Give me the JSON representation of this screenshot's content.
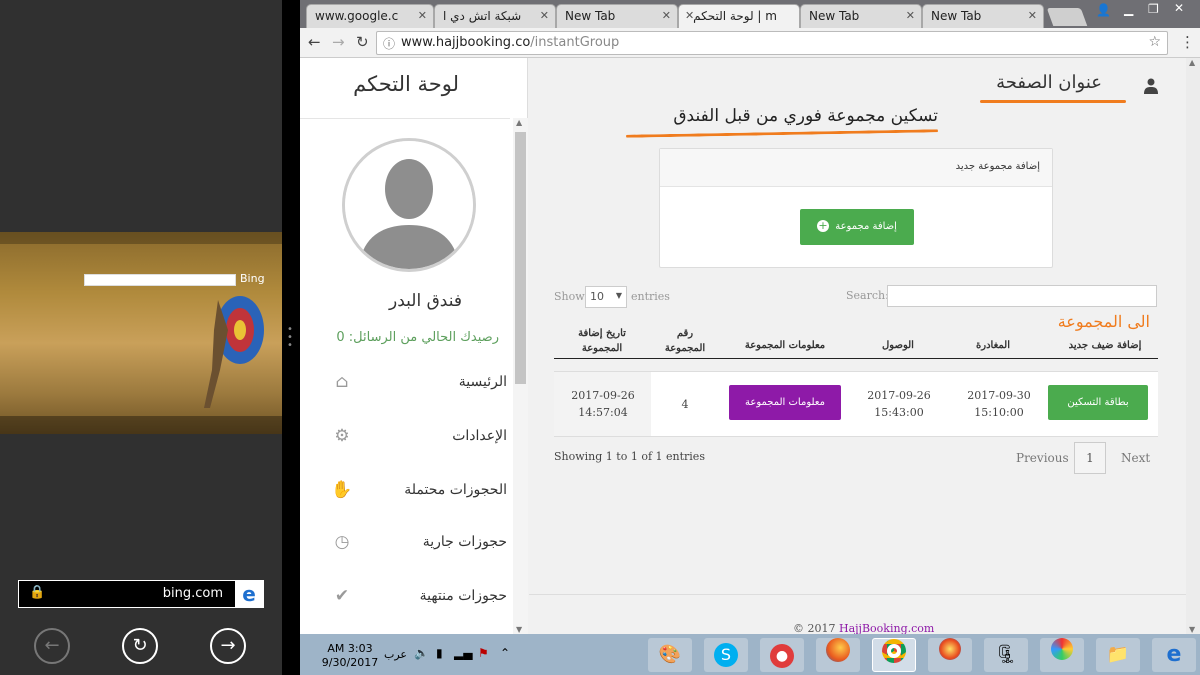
{
  "left_panel": {
    "bing_logo": "Bing",
    "address": "bing.com",
    "ie_icon": "ie-logo-icon",
    "back_icon": "arrow-left-icon",
    "refresh_icon": "refresh-icon",
    "forward_icon": "arrow-right-icon"
  },
  "tabs": [
    {
      "label": "www.google.c"
    },
    {
      "label": "شبكة اتش دي ا"
    },
    {
      "label": "New Tab"
    },
    {
      "label": "m | لوحة التحكم"
    },
    {
      "label": "New Tab"
    },
    {
      "label": "New Tab"
    }
  ],
  "omnibox": {
    "host": "www.hajjbooking.co",
    "path": "/instantGroup"
  },
  "sidebar": {
    "title": "لوحة التحكم",
    "name": "فندق البدر",
    "balance": "رصيدك الحالي من الرسائل: 0",
    "items": [
      {
        "label": "الرئيسية",
        "icon": "home-icon"
      },
      {
        "label": "الإعدادات",
        "icon": "gear-icon"
      },
      {
        "label": "الحجوزات محتملة",
        "icon": "hand-icon"
      },
      {
        "label": "حجوزات جارية",
        "icon": "clock-icon"
      },
      {
        "label": "حجوزات منتهية",
        "icon": "check-icon"
      }
    ]
  },
  "main": {
    "page_heading": "عنوان الصفحة",
    "annotation_title": "تسكين مجموعة فوري من قبل الفندق",
    "annotation_group": "الى المجموعة",
    "add_panel_title": "إضافة مجموعة جديد",
    "add_group_button": "إضافة مجموعة",
    "show_label": "Show",
    "show_value": "10",
    "entries_label": "entries",
    "search_label": "Search:",
    "columns": [
      "إضافة ضيف جديد",
      "المغادرة",
      "الوصول",
      "معلومات المجموعة",
      "رقم المجموعة",
      "تاريخ إضافة المجموعة"
    ],
    "row": {
      "card_button": "بطاقة التسكين",
      "departure_date": "2017-09-30",
      "departure_time": "15:10:00",
      "arrival_date": "2017-09-26",
      "arrival_time": "15:43:00",
      "info_button": "معلومات المجموعة",
      "group_number": "4",
      "added_date": "2017-09-26",
      "added_time": "14:57:04"
    },
    "showing": "Showing 1 to 1 of 1 entries",
    "previous": "Previous",
    "page": "1",
    "next": "Next",
    "footer_prefix": "© 2017 ",
    "footer_link": "HajjBooking.com"
  },
  "taskbar": {
    "time": "AM 3:03",
    "date": "9/30/2017",
    "lang": "عرب"
  },
  "colors": {
    "accent_green": "#4bab4e",
    "accent_purple": "#8e1aa8",
    "annotation_orange": "#f07c1e"
  }
}
